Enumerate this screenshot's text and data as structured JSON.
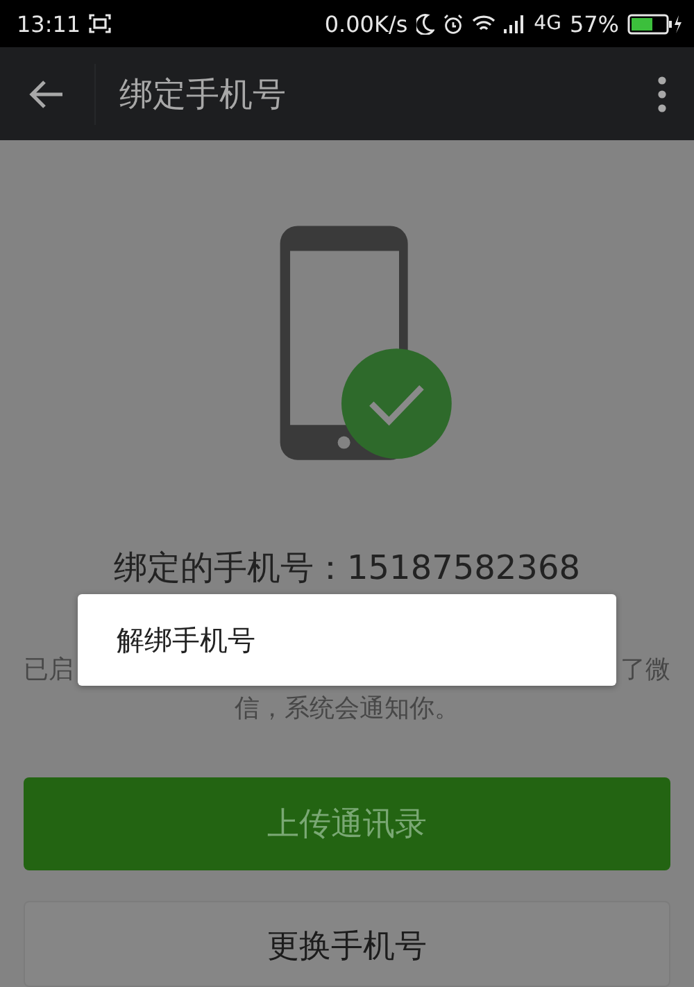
{
  "status_bar": {
    "time": "13:11",
    "network_speed": "0.00K/s",
    "network_type": "4G",
    "battery": "57%"
  },
  "app_bar": {
    "title": "绑定手机号"
  },
  "phone_heading": "绑定的手机号：15187582368",
  "description": {
    "line_1_start": "已启",
    "line_1_end": "了微",
    "line_2": "信，系统会通知你。"
  },
  "dialog": {
    "items": [
      "解绑手机号"
    ]
  },
  "buttons": [
    {
      "label": "上传通讯录",
      "kind": "primary"
    },
    {
      "label": "更换手机号",
      "kind": "secondary"
    }
  ]
}
